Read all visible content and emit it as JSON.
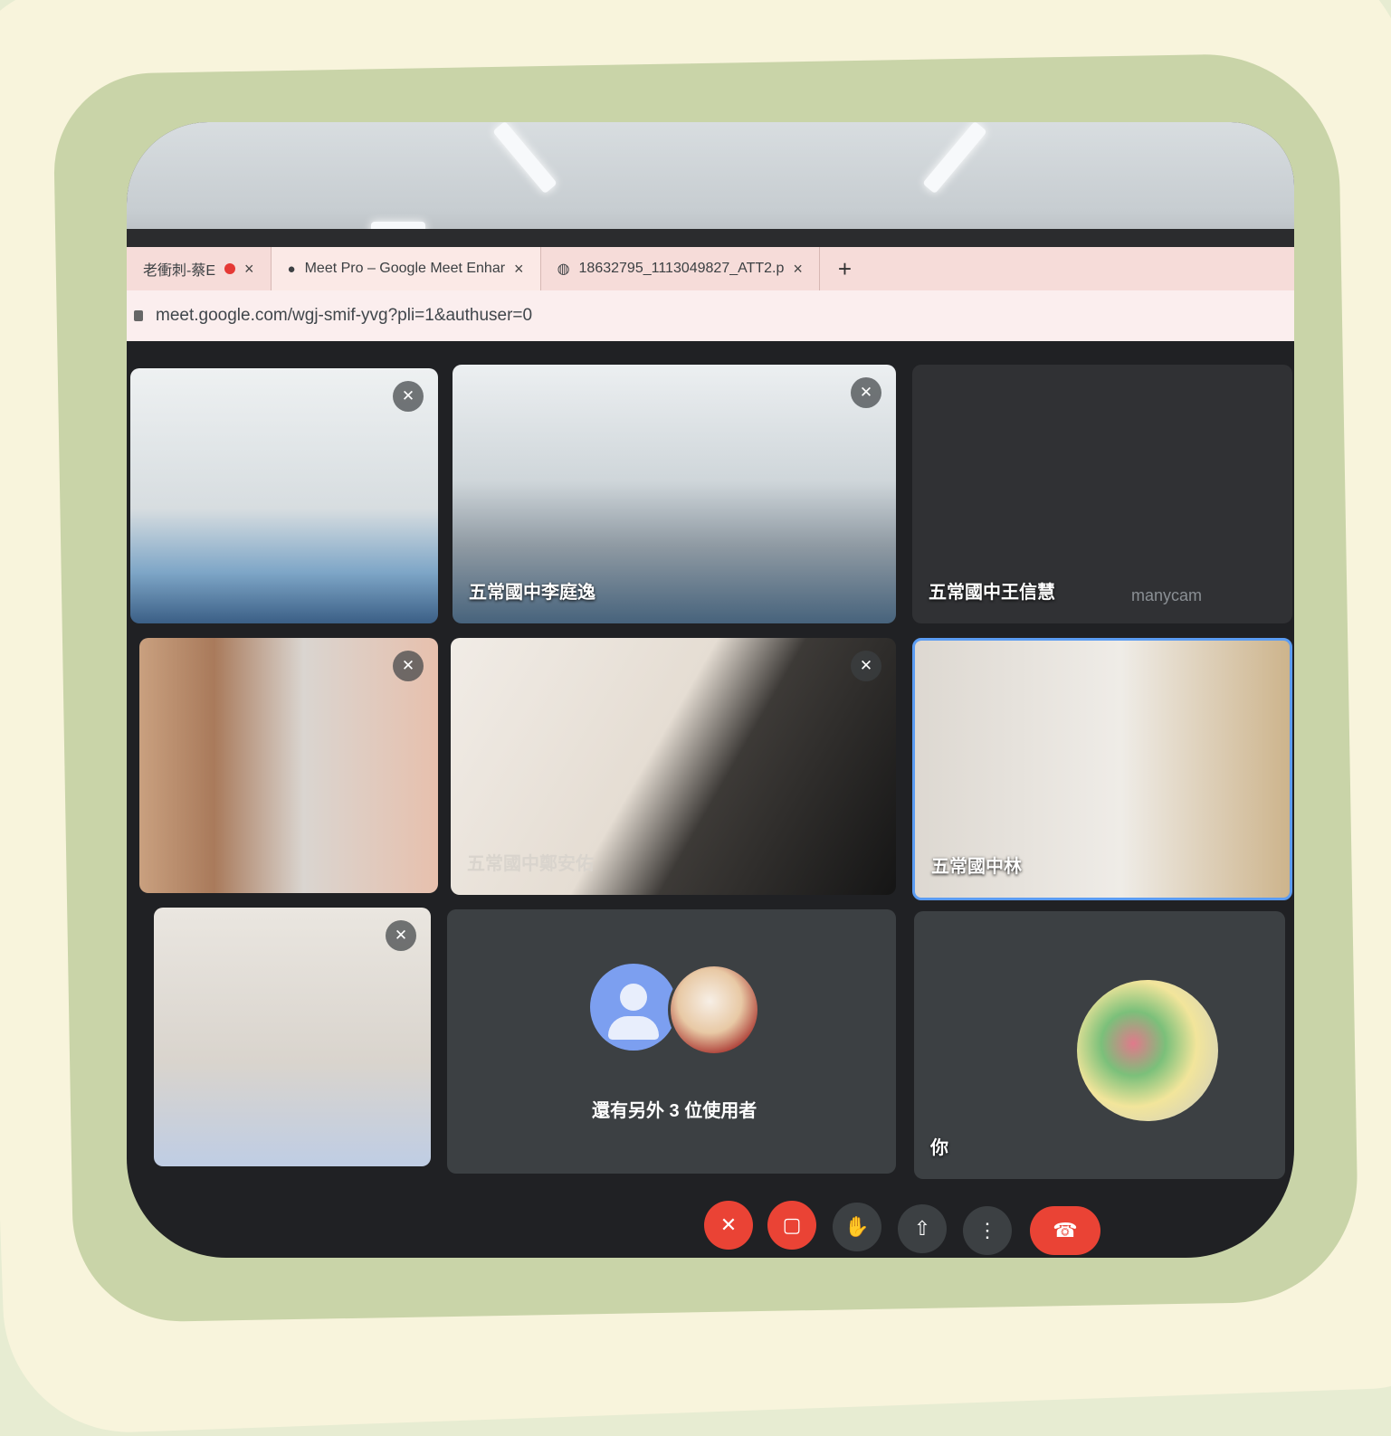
{
  "browser": {
    "tabs": [
      {
        "label": "老衝刺-蔡E",
        "recording": true
      },
      {
        "label": "Meet Pro – Google Meet Enhar",
        "icon": "meet-icon"
      },
      {
        "label": "18632795_1113049827_ATT2.p",
        "icon": "globe-icon"
      }
    ],
    "close_glyph": "×",
    "new_tab_glyph": "+",
    "url": "meet.google.com/wgj-smif-yvg?pli=1&authuser=0"
  },
  "meet": {
    "tiles": [
      {
        "name": "",
        "muted": true
      },
      {
        "name": "五常國中李庭逸",
        "muted": true
      },
      {
        "name": "五常國中王信慧",
        "muted": false,
        "watermark": "manycam"
      },
      {
        "name": "",
        "muted": true
      },
      {
        "name": "五常國中鄭安佑",
        "muted": true
      },
      {
        "name": "五常國中林",
        "muted": false,
        "active_speaker": true
      },
      {
        "name": "",
        "muted": true
      },
      {
        "name": "",
        "more_label": "還有另外 3 位使用者"
      },
      {
        "name": "你"
      }
    ],
    "controls": {
      "mic": "mic-off-icon",
      "camera": "camera-off-icon",
      "raise_hand": "hand-icon",
      "present": "present-icon",
      "more": "more-vert-icon",
      "leave": "hangup-icon"
    },
    "accent_blue": "#5b9cf2",
    "danger_red": "#ea4335"
  }
}
